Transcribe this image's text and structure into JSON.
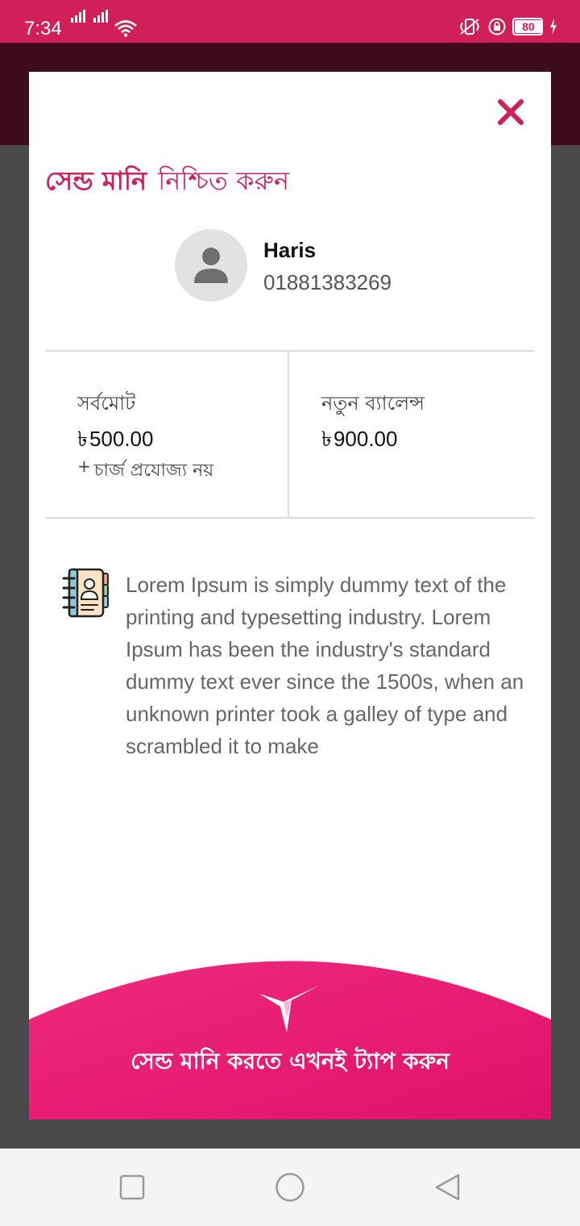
{
  "status_bar": {
    "time": "7:34",
    "battery": "80",
    "background": "#d01f59"
  },
  "modal": {
    "close_icon": "close-icon",
    "title_bold": "সেন্ড মানি",
    "title_light": "নিশ্চিত করুন",
    "recipient": {
      "name": "Haris",
      "phone": "01881383269",
      "avatar_icon": "person-icon"
    },
    "summary": {
      "total_label": "সর্বমোট",
      "currency_symbol": "৳",
      "total_amount": "500.00",
      "charge_note": "চার্জ প্রযোজ্য নয়",
      "charge_prefix": "+",
      "new_balance_label": "নতুন ব্যালেন্স",
      "new_balance_amount": "900.00"
    },
    "note_icon": "contact-book-icon",
    "note_text": "Lorem Ipsum is simply dummy text of the printing and typesetting industry. Lorem Ipsum has been the industry's standard dummy text ever since the 1500s, when an unknown printer took a galley of type and scrambled it to make",
    "cta": {
      "logo_icon": "bird-logo-icon",
      "label": "সেন্ড মানি করতে এখনই ট্যাপ করুন"
    },
    "accent_color": "#d01f59",
    "cta_color": "#e3156f"
  },
  "nav_bar": {
    "recent_icon": "square-recents-icon",
    "home_icon": "circle-home-icon",
    "back_icon": "triangle-back-icon"
  }
}
